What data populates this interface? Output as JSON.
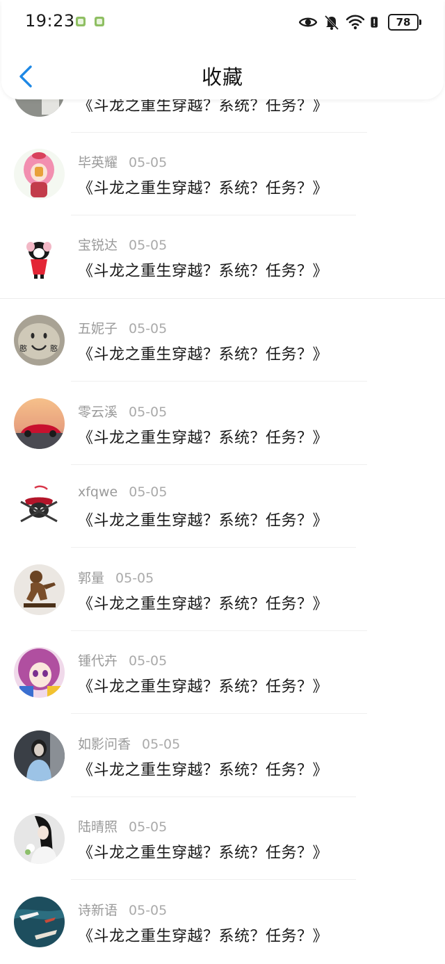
{
  "status_bar": {
    "time": "19:23",
    "battery": "78"
  },
  "header": {
    "title": "收藏"
  },
  "items": [
    {
      "user": "",
      "date": "",
      "title": "《斗龙之重生穿越？系统？任务？》",
      "avatar": "partial-avatar"
    },
    {
      "user": "毕英耀",
      "date": "05-05",
      "title": "《斗龙之重生穿越？系统？任务？》",
      "avatar": "pink-hair-girl"
    },
    {
      "user": "宝锐达",
      "date": "05-05",
      "title": "《斗龙之重生穿越？系统？任务？》",
      "avatar": "cartoon-dog"
    },
    {
      "user": "五妮子",
      "date": "05-05",
      "title": "《斗龙之重生穿越？系统？任务？》",
      "avatar": "smiley-cloud"
    },
    {
      "user": "零云溪",
      "date": "05-05",
      "title": "《斗龙之重生穿越？系统？任务？》",
      "avatar": "red-sports-car"
    },
    {
      "user": "xfqwe",
      "date": "05-05",
      "title": "《斗龙之重生穿越？系统？任务？》",
      "avatar": "pirate-skull"
    },
    {
      "user": "郭量",
      "date": "05-05",
      "title": "《斗龙之重生穿越？系统？任务？》",
      "avatar": "bronze-figure"
    },
    {
      "user": "锺代卉",
      "date": "05-05",
      "title": "《斗龙之重生穿越？系统？任务？》",
      "avatar": "anime-girl"
    },
    {
      "user": "如影问香",
      "date": "05-05",
      "title": "《斗龙之重生穿越？系统？任务？》",
      "avatar": "girl-in-jacket"
    },
    {
      "user": "陆晴照",
      "date": "05-05",
      "title": "《斗龙之重生穿越？系统？任务？》",
      "avatar": "girl-with-flowers"
    },
    {
      "user": "诗新语",
      "date": "05-05",
      "title": "《斗龙之重生穿越？系统？任务？》",
      "avatar": "boats-on-water"
    }
  ],
  "colors": {
    "accent": "#1e88e5",
    "meta_text": "#9a9a9a",
    "divider": "#efefef"
  },
  "icons": [
    "back-arrow-icon",
    "eye-icon",
    "bell-off-icon",
    "wifi-icon",
    "alert-icon",
    "battery-icon"
  ]
}
